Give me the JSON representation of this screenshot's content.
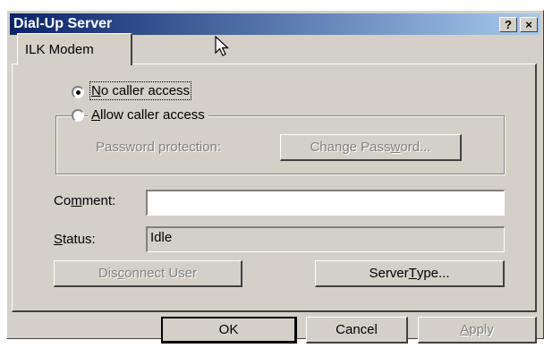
{
  "window": {
    "title": "Dial-Up Server",
    "help_glyph": "?",
    "close_glyph": "×"
  },
  "tabs": [
    {
      "label": "ILK Modem",
      "selected": true
    }
  ],
  "access": {
    "no_caller": {
      "pre": "",
      "key": "N",
      "post": "o caller access",
      "selected": true
    },
    "allow_caller": {
      "pre": "",
      "key": "A",
      "post": "llow caller access",
      "selected": false
    }
  },
  "password": {
    "label": "Password protection:",
    "button": {
      "pre": "Change Pass",
      "key": "w",
      "post": "ord..."
    }
  },
  "comment": {
    "pre": "Co",
    "key": "m",
    "post": "ment:",
    "value": ""
  },
  "status": {
    "pre": "",
    "key": "S",
    "post": "tatus:",
    "value": "Idle"
  },
  "actions": {
    "disconnect": {
      "pre": "Dis",
      "key": "c",
      "post": "onnect User"
    },
    "server_type": {
      "pre": "Server ",
      "key": "T",
      "post": "ype..."
    }
  },
  "footer": {
    "ok": "OK",
    "cancel": "Cancel",
    "apply": {
      "pre": "",
      "key": "A",
      "post": "pply"
    }
  },
  "colors": {
    "face": "#d4d0c8",
    "title_start": "#0a246a",
    "title_end": "#a6caf0",
    "disabled_text": "#808080"
  }
}
